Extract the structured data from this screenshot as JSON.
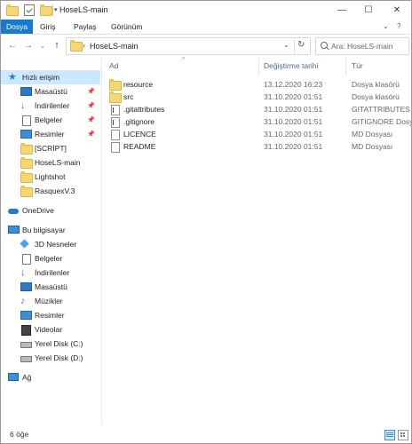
{
  "window": {
    "title": "HoseLS-main"
  },
  "window_buttons": {
    "minimize": "—",
    "maximize": "☐",
    "close": "✕"
  },
  "ribbon": {
    "tabs": [
      {
        "label": "Dosya"
      },
      {
        "label": "Giriş"
      },
      {
        "label": "Paylaş"
      },
      {
        "label": "Görünüm"
      }
    ],
    "collapse_glyph": "⌄",
    "help_glyph": "?"
  },
  "address": {
    "separator": "›",
    "path": "HoseLS-main",
    "dropdown_glyph": "⌄",
    "refresh_glyph": "↻"
  },
  "search": {
    "placeholder": "Ara: HoseLS-main"
  },
  "nav": {
    "back": "←",
    "forward": "→",
    "history": "⌄",
    "up": "↑"
  },
  "sidebar": {
    "quick_access": {
      "label": "Hızlı erişim",
      "items": [
        {
          "label": "Masaüstü",
          "pinned": true,
          "icon": "desktop-icon"
        },
        {
          "label": "İndirilenler",
          "pinned": true,
          "icon": "download-icon"
        },
        {
          "label": "Belgeler",
          "pinned": true,
          "icon": "documents-icon"
        },
        {
          "label": "Resimler",
          "pinned": true,
          "icon": "pictures-icon"
        },
        {
          "label": "[SCRİPT]",
          "pinned": false,
          "icon": "folder-icon"
        },
        {
          "label": "HoseLS-main",
          "pinned": false,
          "icon": "folder-icon"
        },
        {
          "label": "Lightshot",
          "pinned": false,
          "icon": "folder-icon"
        },
        {
          "label": "RasquexV.3",
          "pinned": false,
          "icon": "folder-icon"
        }
      ]
    },
    "onedrive": {
      "label": "OneDrive"
    },
    "this_pc": {
      "label": "Bu bilgisayar",
      "items": [
        {
          "label": "3D Nesneler",
          "icon": "3d-objects-icon"
        },
        {
          "label": "Belgeler",
          "icon": "documents-icon"
        },
        {
          "label": "İndirilenler",
          "icon": "download-icon"
        },
        {
          "label": "Masaüstü",
          "icon": "desktop-icon"
        },
        {
          "label": "Müzikler",
          "icon": "music-icon"
        },
        {
          "label": "Resimler",
          "icon": "pictures-icon"
        },
        {
          "label": "Videolar",
          "icon": "video-icon"
        },
        {
          "label": "Yerel Disk (C:)",
          "icon": "drive-icon"
        },
        {
          "label": "Yerel Disk (D:)",
          "icon": "drive-icon"
        }
      ]
    },
    "network": {
      "label": "Ağ"
    }
  },
  "columns": {
    "name": "Ad",
    "date": "Değiştirme tarihi",
    "type": "Tür"
  },
  "files": [
    {
      "name": "resource",
      "date": "13.12.2020 16:23",
      "type": "Dosya klasörü",
      "kind": "folder"
    },
    {
      "name": "src",
      "date": "31.10.2020 01:51",
      "type": "Dosya klasörü",
      "kind": "folder"
    },
    {
      "name": ".gitattributes",
      "date": "31.10.2020 01:51",
      "type": "GITATTRIBUTES Do...",
      "kind": "file"
    },
    {
      "name": ".gitignore",
      "date": "31.10.2020 01:51",
      "type": "GITIGNORE Dosyası",
      "kind": "file"
    },
    {
      "name": "LICENCE",
      "date": "31.10.2020 01:51",
      "type": "MD Dosyası",
      "kind": "file"
    },
    {
      "name": "README",
      "date": "31.10.2020 01:51",
      "type": "MD Dosyası",
      "kind": "file"
    }
  ],
  "status": {
    "count": "6 öğe"
  },
  "colors": {
    "accent": "#1979ca",
    "selection": "#cce8ff",
    "folder": "#f7d674"
  }
}
